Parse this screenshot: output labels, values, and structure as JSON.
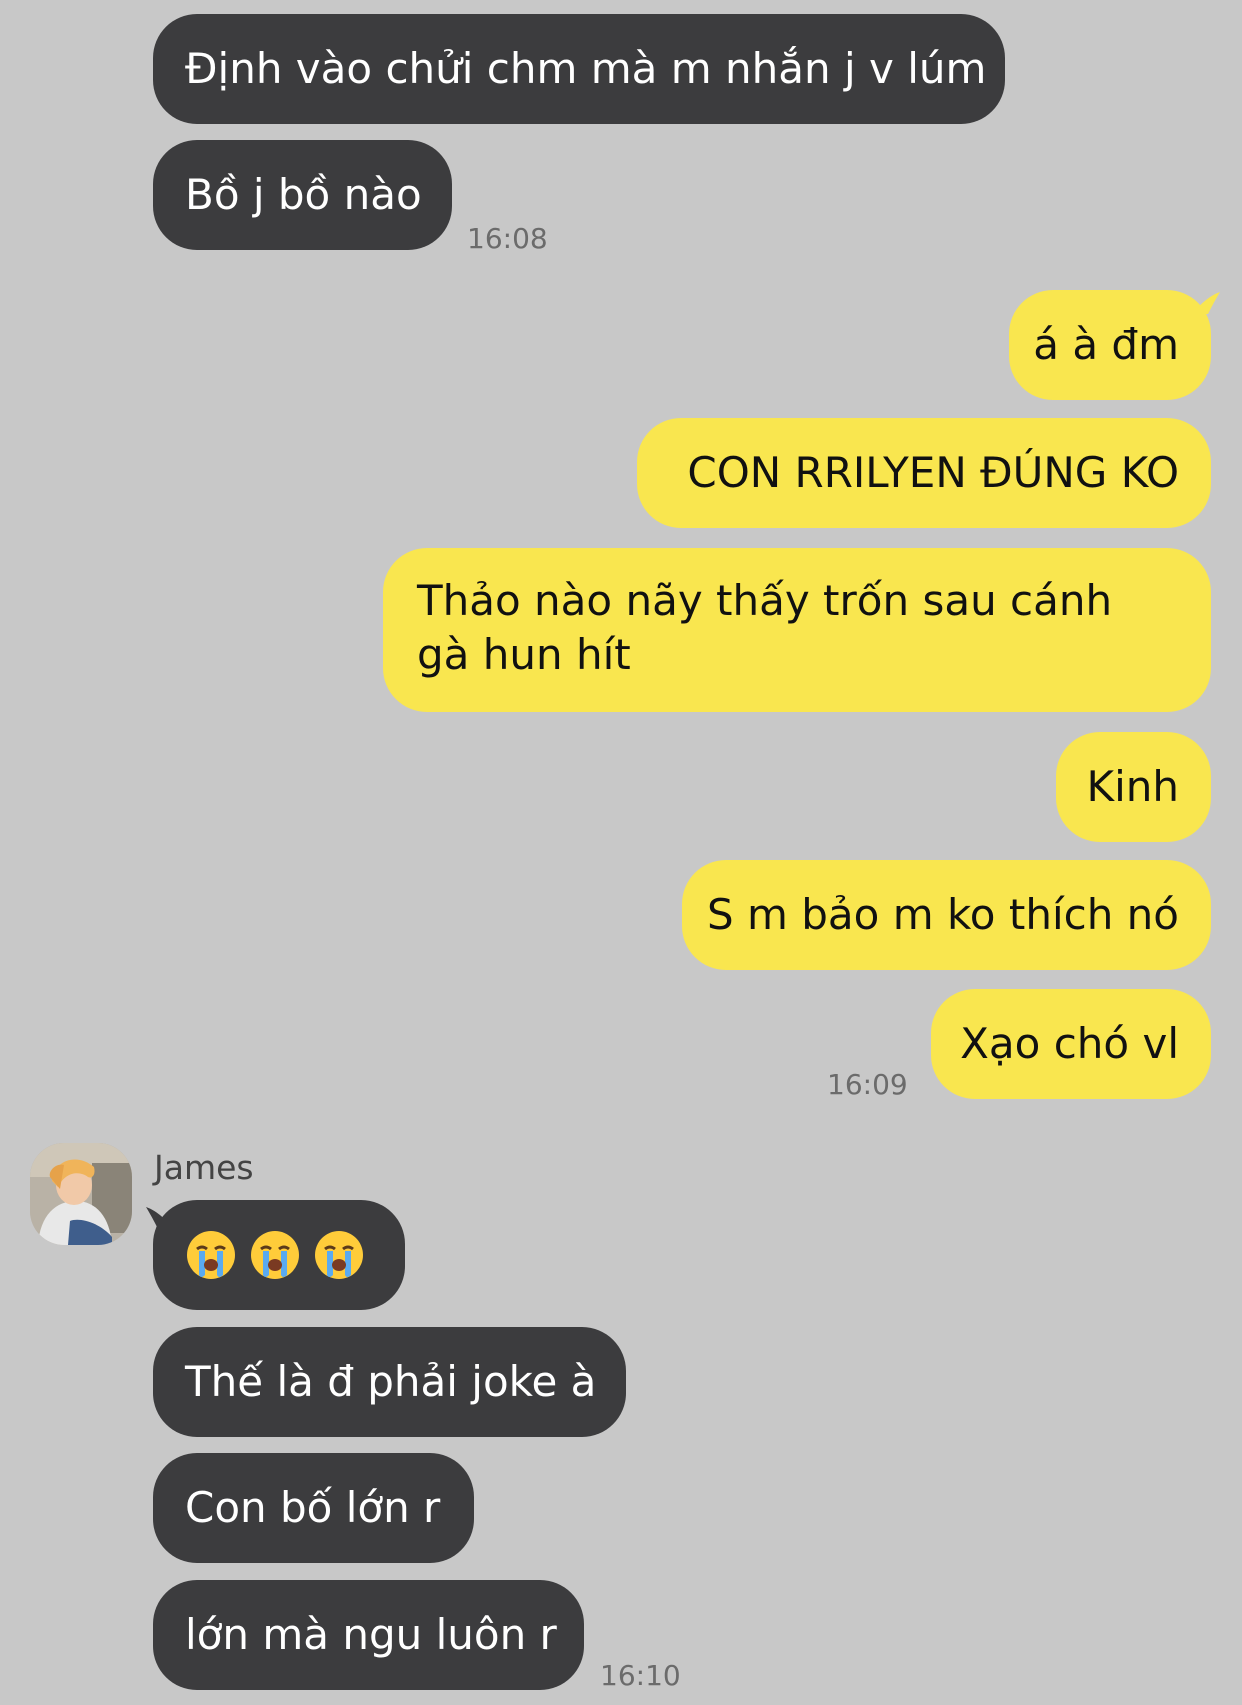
{
  "colors": {
    "background": "#c8c8c8",
    "incoming_bubble": "#3c3c3e",
    "outgoing_bubble": "#f9e64f",
    "timestamp": "#6b6b6b"
  },
  "incoming_group_1": {
    "messages": [
      "Định vào chửi chm mà m nhắn j v lúm",
      "Bồ j bồ nào"
    ],
    "time": "16:08"
  },
  "outgoing_group": {
    "messages": [
      "á à đm",
      "CON RRILYEN ĐÚNG KO",
      "Thảo nào nãy thấy trốn sau cánh gà hun hít",
      "Kinh",
      "S m bảo m ko thích nó",
      "Xạo chó vl"
    ],
    "time": "16:09"
  },
  "incoming_group_2": {
    "sender": "James",
    "avatar_icon": "user-avatar-photo",
    "emoji_icon": "loudly-crying-face-emoji",
    "emoji_count": 3,
    "messages": [
      "Thế là đ phải joke à",
      "Con bố lớn r",
      "lớn mà ngu luôn r"
    ],
    "time": "16:10"
  }
}
